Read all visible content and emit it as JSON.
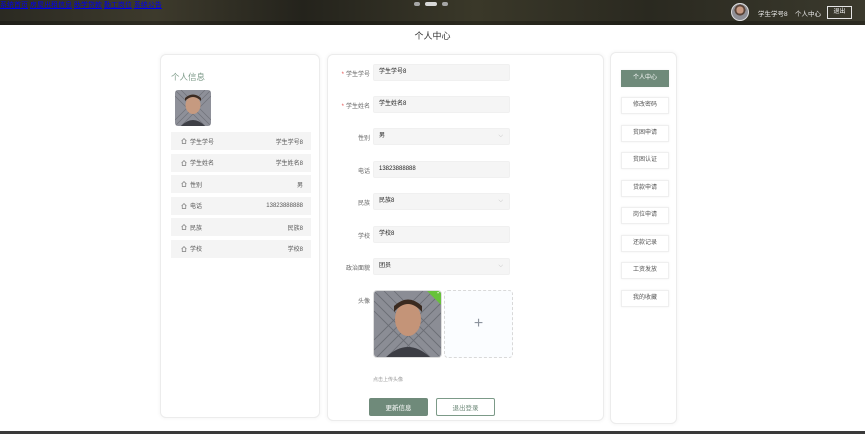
{
  "nav": {
    "items": [
      "系统首页",
      "房屋出租信息",
      "助学贷款",
      "勤工岗位",
      "系统公告"
    ]
  },
  "header": {
    "user_name": "学生学号8",
    "personal_center": "个人中心",
    "logout_label": "退出"
  },
  "page": {
    "title": "个人中心"
  },
  "left_panel": {
    "title": "个人信息",
    "rows": [
      {
        "label": "学生学号",
        "value": "学生学号8"
      },
      {
        "label": "学生姓名",
        "value": "学生姓名8"
      },
      {
        "label": "性别",
        "value": "男"
      },
      {
        "label": "电话",
        "value": "13823888888"
      },
      {
        "label": "民族",
        "value": "民族8"
      },
      {
        "label": "学校",
        "value": "学校8"
      }
    ]
  },
  "form": {
    "fields": [
      {
        "label": "学生学号",
        "value": "学生学号8",
        "required": true
      },
      {
        "label": "学生姓名",
        "value": "学生姓名8",
        "required": true
      },
      {
        "label": "性别",
        "value": "男",
        "required": false
      },
      {
        "label": "电话",
        "value": "13823888888",
        "required": false
      },
      {
        "label": "民族",
        "value": "民族8",
        "required": false
      },
      {
        "label": "学校",
        "value": "学校8",
        "required": false
      },
      {
        "label": "政治面貌",
        "value": "团员",
        "required": false
      }
    ],
    "avatar_label": "头像",
    "upload_tip": "点击上传头像",
    "update_button": "更新信息",
    "logout_button": "退出登录"
  },
  "menu": {
    "items": [
      "个人中心",
      "修改密码",
      "贫困申请",
      "贫困认证",
      "贷款申请",
      "岗位申请",
      "还款记录",
      "工资发放",
      "我的收藏"
    ],
    "active_index": 0
  },
  "colors": {
    "accent": "#6f8a7a",
    "required": "#e24c4c",
    "upload_success": "#67c23a"
  }
}
